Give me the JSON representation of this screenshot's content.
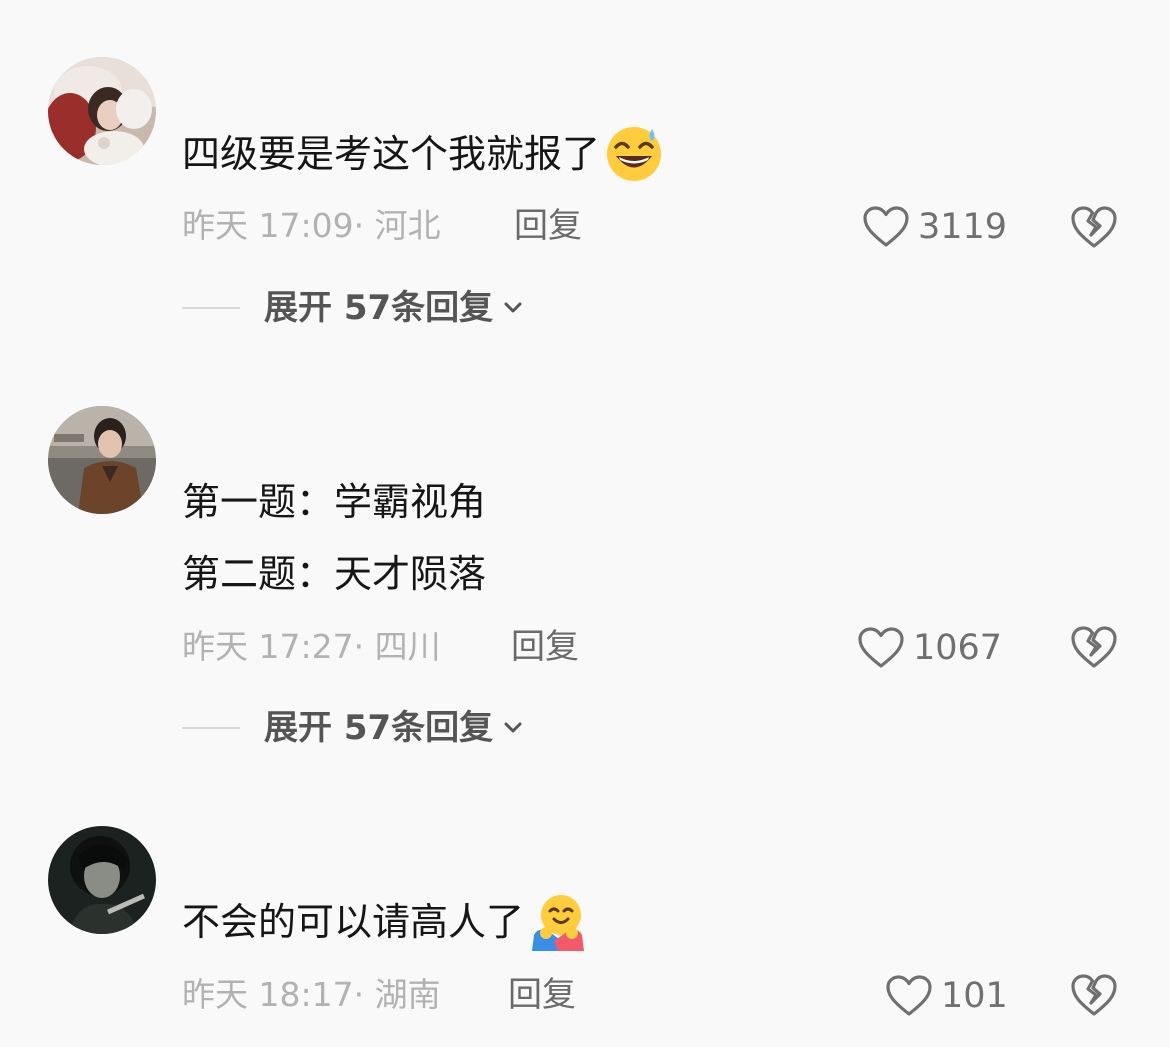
{
  "comments": [
    {
      "avatar_icon": "avatar-girl-with-cat",
      "lines": [
        "四级要是考这个我就报了"
      ],
      "emoji": "grinning-sweat-emoji",
      "time": "昨天 17:09",
      "location": "· 河北",
      "reply_label": "回复",
      "likes": "3119",
      "expand_label": "展开 57条回复"
    },
    {
      "avatar_icon": "avatar-man-in-jacket",
      "lines": [
        "第一题：学霸视角",
        "第二题：天才陨落"
      ],
      "time": "昨天 17:27",
      "location": "· 四川",
      "reply_label": "回复",
      "likes": "1067",
      "expand_label": "展开 57条回复"
    },
    {
      "avatar_icon": "avatar-dark-portrait",
      "lines": [
        "不会的可以请高人了"
      ],
      "emoji": "hugging-face-emoji",
      "time": "昨天 18:17",
      "location": "· 湖南",
      "reply_label": "回复",
      "likes": "101"
    }
  ],
  "colors": {
    "background": "#f9f9f9",
    "comment_text": "#161616",
    "meta_text": "#b2b2b2",
    "reply_text": "#6a6a6a",
    "expand_text": "#555555"
  }
}
